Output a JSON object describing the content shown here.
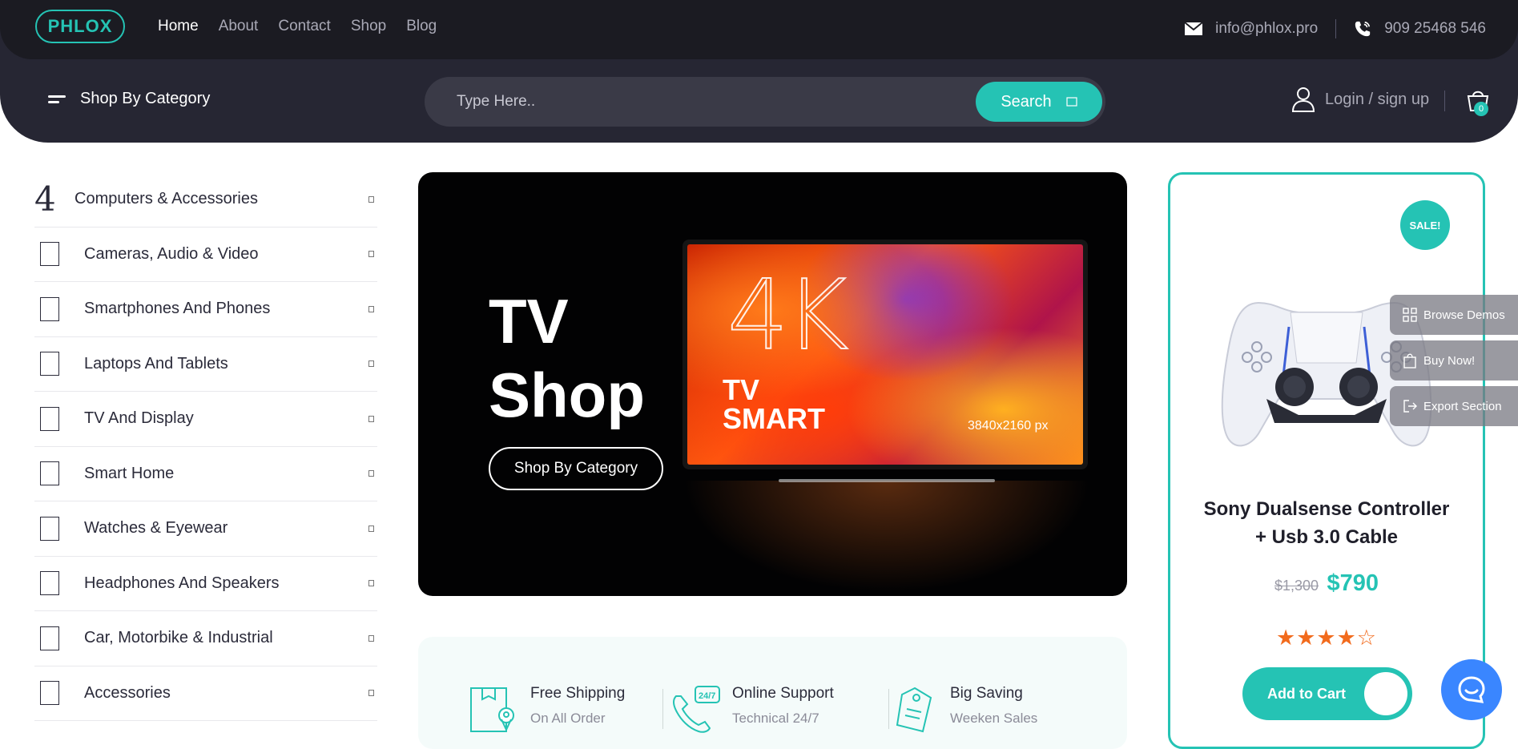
{
  "header": {
    "logo": "PHLOX",
    "nav": [
      {
        "label": "Home",
        "active": true
      },
      {
        "label": "About"
      },
      {
        "label": "Contact"
      },
      {
        "label": "Shop"
      },
      {
        "label": "Blog"
      }
    ],
    "email": "info@phlox.pro",
    "phone": "909 25468 546",
    "category_toggle": "Shop By Category",
    "search": {
      "placeholder": "Type Here..",
      "button": "Search"
    },
    "login": "Login / sign up",
    "cart_count": "0"
  },
  "sidebar": {
    "items": [
      {
        "label": "Computers & Accessories",
        "number": "4"
      },
      {
        "label": "Cameras, Audio & Video"
      },
      {
        "label": "Smartphones And Phones"
      },
      {
        "label": "Laptops And Tablets"
      },
      {
        "label": "TV And Display"
      },
      {
        "label": "Smart Home"
      },
      {
        "label": "Watches & Eyewear"
      },
      {
        "label": "Headphones And Speakers"
      },
      {
        "label": "Car, Motorbike & Industrial"
      },
      {
        "label": "Accessories"
      }
    ]
  },
  "hero": {
    "title_line1": "TV",
    "title_line2": "Shop",
    "button": "Shop By Category",
    "tv_badge": "4K",
    "tv_text_line1": "TV",
    "tv_text_line2": "SMART",
    "tv_resolution": "3840x2160 px"
  },
  "features": [
    {
      "title": "Free Shipping",
      "subtitle": "On All Order"
    },
    {
      "title": "Online Support",
      "subtitle": "Technical 24/7"
    },
    {
      "title": "Big Saving",
      "subtitle": "Weeken Sales"
    }
  ],
  "product": {
    "badge": "SALE!",
    "title_line1": "Sony Dualsense Controller",
    "title_line2": "+ Usb 3.0 Cable",
    "old_price": "$1,300",
    "new_price": "$790",
    "rating": 4,
    "rating_max": 5,
    "stars_text": "★★★★☆",
    "add_to_cart": "Add to Cart"
  },
  "side_tools": [
    {
      "label": "Browse Demos",
      "icon": "grid-icon"
    },
    {
      "label": "Buy Now!",
      "icon": "bag-icon"
    },
    {
      "label": "Export Section",
      "icon": "export-icon"
    }
  ],
  "colors": {
    "accent": "#25c3b4",
    "header": "#262633",
    "topbar": "#1b1b22",
    "star": "#f26b1d",
    "help": "#3a86ff"
  }
}
